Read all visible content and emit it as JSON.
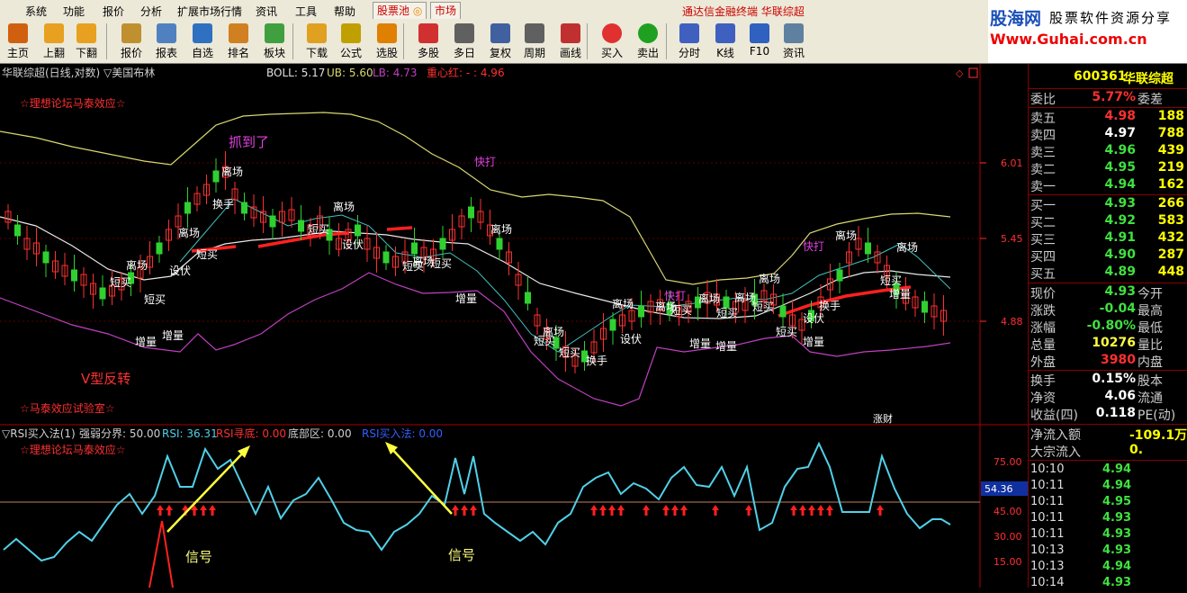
{
  "menu": [
    "系统",
    "功能",
    "报价",
    "分析",
    "扩展市场行情",
    "资讯",
    "工具",
    "帮助"
  ],
  "tabs": [
    "股票池",
    "市场"
  ],
  "window_title": "通达信金融终端  华联综超",
  "toolbar": [
    "主页",
    "上翻",
    "下翻",
    "报价",
    "报表",
    "自选",
    "排名",
    "板块",
    "下载",
    "公式",
    "选股",
    "多股",
    "多日",
    "复权",
    "周期",
    "画线",
    "买入",
    "卖出",
    "分时",
    "K线",
    "F10",
    "资讯"
  ],
  "logo": {
    "brand": "股海网",
    "slogan": "股票软件资源分享",
    "url": "Www.Guhai.com.cn"
  },
  "main_header": {
    "name": "华联综超(日线,对数) ▽美国布林",
    "boll": "BOLL: 5.17",
    "ub": "UB: 5.60",
    "lb": "LB: 4.73",
    "zxh": "重心红: - : 4.96"
  },
  "annotations": {
    "forum_top": "☆理想论坛马泰效应☆",
    "forum_bottom": "☆马泰效应试验室☆",
    "v_reversal": "V型反转",
    "caught": "抓到了",
    "signal": "信号",
    "news_tag": "涨财"
  },
  "price_axis": [
    "6.01",
    "5.45",
    "4.88"
  ],
  "rsi_header": {
    "name": "▽RSI买入法(1)",
    "strength": "强弱分界: 50.00",
    "rsi": "RSI: 36.31",
    "rsi_bottom": "RSI寻底: 0.00",
    "bottom_zone": "底部区: 0.00",
    "rsi_buy": "RSI买入法: 0.00"
  },
  "rsi_axis": [
    "75.00",
    "45.00",
    "30.00",
    "15.00"
  ],
  "rsi_current": "54.36",
  "colors": {
    "up": "#ff3030",
    "down": "#00e4e4",
    "ma": "#ffffff",
    "upper": "#d8d870",
    "lower": "#c040c0",
    "rsi": "#50d0e8"
  },
  "stock": {
    "code": "600361",
    "name": "华联综超"
  },
  "quote_header": {
    "wb_label": "委比",
    "wb_value": "5.77%",
    "wc_label": "委差"
  },
  "asks": [
    {
      "label": "卖五",
      "price": "4.98",
      "vol": "188"
    },
    {
      "label": "卖四",
      "price": "4.97",
      "vol": "788"
    },
    {
      "label": "卖三",
      "price": "4.96",
      "vol": "439"
    },
    {
      "label": "卖二",
      "price": "4.95",
      "vol": "219"
    },
    {
      "label": "卖一",
      "price": "4.94",
      "vol": "162"
    }
  ],
  "bids": [
    {
      "label": "买一",
      "price": "4.93",
      "vol": "266"
    },
    {
      "label": "买二",
      "price": "4.92",
      "vol": "583"
    },
    {
      "label": "买三",
      "price": "4.91",
      "vol": "432"
    },
    {
      "label": "买四",
      "price": "4.90",
      "vol": "287"
    },
    {
      "label": "买五",
      "price": "4.89",
      "vol": "448"
    }
  ],
  "stats": [
    {
      "l1": "现价",
      "v1": "4.93",
      "l2": "今开"
    },
    {
      "l1": "涨跌",
      "v1": "-0.04",
      "l2": "最高"
    },
    {
      "l1": "涨幅",
      "v1": "-0.80%",
      "l2": "最低"
    },
    {
      "l1": "总量",
      "v1": "10276",
      "l2": "量比"
    },
    {
      "l1": "外盘",
      "v1": "3980",
      "l2": "内盘"
    }
  ],
  "stats2": [
    {
      "l1": "换手",
      "v1": "0.15%",
      "l2": "股本"
    },
    {
      "l1": "净资",
      "v1": "4.06",
      "l2": "流通"
    },
    {
      "l1": "收益(四)",
      "v1": "0.118",
      "l2": "PE(动)"
    }
  ],
  "flow": [
    {
      "label": "净流入额",
      "value": "-109.1万"
    },
    {
      "label": "大宗流入",
      "value": "0."
    }
  ],
  "ticks": [
    {
      "time": "10:10",
      "price": "4.94"
    },
    {
      "time": "10:11",
      "price": "4.94"
    },
    {
      "time": "10:11",
      "price": "4.95"
    },
    {
      "time": "10:11",
      "price": "4.93"
    },
    {
      "time": "10:11",
      "price": "4.93"
    },
    {
      "time": "10:13",
      "price": "4.93"
    },
    {
      "time": "10:13",
      "price": "4.94"
    },
    {
      "time": "10:14",
      "price": "4.93"
    }
  ]
}
